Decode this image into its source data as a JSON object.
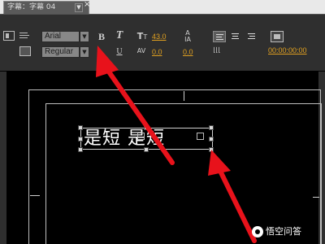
{
  "tab": {
    "title": "字幕：字幕 04",
    "menu_glyph": "▼",
    "close_glyph": "×"
  },
  "toolbar": {
    "font_family": "Arial",
    "font_style": "Regular",
    "dropdown_arrow": "▼",
    "bold_label": "B",
    "italic_label": "T",
    "underline_label": "U",
    "font_size_value": "43.0",
    "kerning_value": "0.0",
    "leading_value": "0.0",
    "tracking_value": "0.0",
    "timecode": "00:00:00:00"
  },
  "canvas": {
    "text_content": "是短 是短"
  },
  "watermark": {
    "text": "悟空问答"
  },
  "colors": {
    "accent_value": "#e0a020",
    "panel_bg": "#2f2f2f",
    "canvas_bg": "#000000",
    "arrow": "#e8121b"
  }
}
